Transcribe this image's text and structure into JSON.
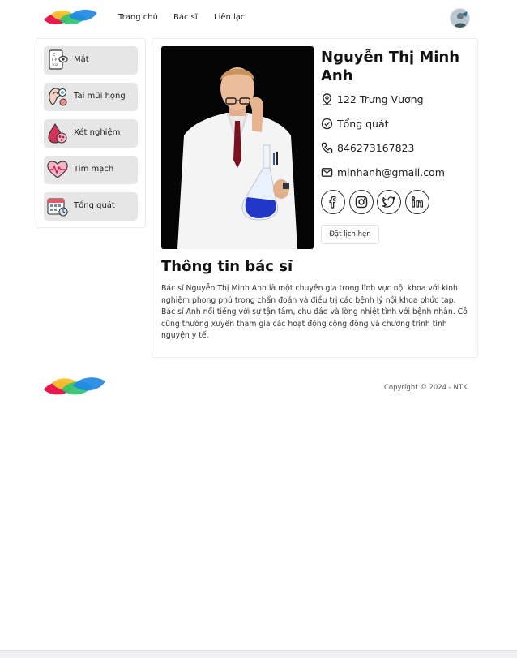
{
  "nav": {
    "home": "Trang chủ",
    "doctor": "Bác sĩ",
    "contact": "Liên lạc"
  },
  "sidebar": {
    "items": [
      {
        "label": "Mắt",
        "icon": "eye-chart-icon"
      },
      {
        "label": "Tai mũi họng",
        "icon": "ear-nose-throat-icon"
      },
      {
        "label": "Xét nghiệm",
        "icon": "blood-test-icon"
      },
      {
        "label": "Tim mạch",
        "icon": "heart-rate-icon"
      },
      {
        "label": "Tổng quát",
        "icon": "calendar-checkup-icon"
      }
    ]
  },
  "doctor": {
    "name": "Nguyễn Thị Minh Anh",
    "address": "122 Trưng Vương",
    "specialty": "Tổng quát",
    "phone": "846273167823",
    "email": "minhanh@gmail.com",
    "book_label": "Đặt lịch hẹn"
  },
  "social": [
    "facebook-icon",
    "instagram-icon",
    "twitter-icon",
    "linkedin-icon"
  ],
  "about": {
    "title": "Thông tin bác sĩ",
    "text": "Bác sĩ Nguyễn Thị Minh Anh là một chuyên gia trong lĩnh vực nội khoa với kinh nghiệm phong phú trong chẩn đoán và điều trị các bệnh lý nội khoa phức tạp. Bác sĩ Anh nổi tiếng với sự tận tâm, chu đáo và lòng nhiệt tình với bệnh nhân. Cô cũng thường xuyên tham gia các hoạt động cộng đồng và chương trình tình nguyện y tế."
  },
  "footer": {
    "copyright": "Copyright © 2024 - NTK."
  },
  "colors": {
    "logo_red": "#e8194f",
    "logo_yellow": "#f7c22e",
    "logo_green": "#2fc46f",
    "logo_blue": "#1e88e5",
    "sidebar_item_bg": "#e6e6e6"
  }
}
